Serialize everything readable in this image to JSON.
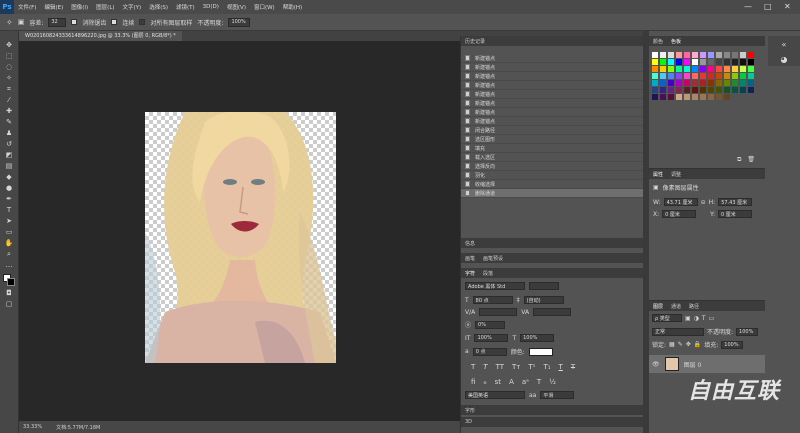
{
  "app": {
    "logo": "Ps"
  },
  "menu": [
    "文件(F)",
    "编辑(E)",
    "图像(I)",
    "图层(L)",
    "文字(Y)",
    "选择(S)",
    "滤镜(T)",
    "3D(D)",
    "视图(V)",
    "窗口(W)",
    "帮助(H)"
  ],
  "window_controls": {
    "minimize": "—",
    "maximize": "□",
    "close": "✕"
  },
  "options": {
    "tolerance_label": "容差:",
    "tolerance_value": "32",
    "antialias_label": "消除锯齿",
    "contiguous_label": "连续",
    "sample_all_label": "对所有图层取样",
    "opacity_label": "不透明度:",
    "opacity_value": "100%"
  },
  "document": {
    "tab_title": "W020160824333614896220.jpg @ 33.3% (图层 0, RGB/8*) *"
  },
  "status": {
    "zoom": "33.33%",
    "doc_size": "文档:5.77M/7.18M"
  },
  "history": {
    "title": "历史记录",
    "items": [
      "新建锚点",
      "新建锚点",
      "新建锚点",
      "新建锚点",
      "新建锚点",
      "新建锚点",
      "新建锚点",
      "新建锚点",
      "闭合路径",
      "选区图形",
      "填充",
      "载入选区",
      "选择反向",
      "羽化",
      "收缩选择",
      "删除通道"
    ],
    "selected_index": 15
  },
  "swatches": {
    "tabs": [
      "颜色",
      "色板"
    ],
    "colors": [
      "#ffffff",
      "#eeeeee",
      "#dddddd",
      "#ff9999",
      "#ff66aa",
      "#ffaacc",
      "#cc99ff",
      "#9999ff",
      "#aaaaaa",
      "#888888",
      "#777777",
      "#cccccc",
      "#ff0000",
      "#ffff00",
      "#00ff00",
      "#00ffff",
      "#0000ff",
      "#ff00ff",
      "#ffffff",
      "#999999",
      "#666666",
      "#444444",
      "#333333",
      "#222222",
      "#111111",
      "#000000",
      "#ff8800",
      "#ffcc00",
      "#88ff00",
      "#00ff88",
      "#00ffcc",
      "#0088ff",
      "#8800ff",
      "#ff0088",
      "#ff4444",
      "#ff8844",
      "#ffcc44",
      "#ccff44",
      "#44ff44",
      "#44ffcc",
      "#44ccff",
      "#4488ff",
      "#8844ff",
      "#ff44cc",
      "#ff6666",
      "#ee3333",
      "#dd2222",
      "#cc4400",
      "#cc8800",
      "#88cc00",
      "#00cc44",
      "#00cc99",
      "#00aacc",
      "#0066cc",
      "#4400cc",
      "#aa00cc",
      "#cc0066",
      "#993333",
      "#aa2222",
      "#883300",
      "#886600",
      "#668800",
      "#228833",
      "#008866",
      "#006688",
      "#224488",
      "#332288",
      "#662288",
      "#882255",
      "#552222",
      "#661111",
      "#553300",
      "#554400",
      "#445500",
      "#115522",
      "#005544",
      "#004455",
      "#112255",
      "#221155",
      "#441155",
      "#551133",
      "#ccaa88",
      "#bb9977",
      "#aa8866",
      "#997755",
      "#886644",
      "#775533",
      "#664422"
    ]
  },
  "properties": {
    "tabs": [
      "属性",
      "调整"
    ],
    "title": "像素图层属性",
    "w_label": "W:",
    "w_value": "43.71 厘米",
    "h_label": "H:",
    "h_value": "57.43 厘米",
    "x_label": "X:",
    "x_value": "0 厘米",
    "y_label": "Y:",
    "y_value": "0 厘米"
  },
  "info": {
    "title": "信息"
  },
  "brushes": {
    "tabs": [
      "画笔",
      "画笔预设"
    ]
  },
  "character": {
    "tabs": [
      "字符",
      "段落"
    ],
    "font": "Adobe 黑体 Std",
    "size": "80 点",
    "leading": "(自动)",
    "kerning": "",
    "tracking": "",
    "scale_pct": "0%",
    "vscale": "100%",
    "hscale": "100%",
    "baseline": "0 点",
    "color_label": "颜色:",
    "language": "美国英语",
    "aa": "平滑"
  },
  "layers": {
    "tabs": [
      "图层",
      "通道",
      "路径"
    ],
    "kind_label": "ρ 类型",
    "blend": "正常",
    "opacity_label": "不透明度:",
    "opacity": "100%",
    "lock_label": "锁定:",
    "fill_label": "填充:",
    "fill": "100%",
    "layer_name": "图层 0"
  },
  "bottom_panels": {
    "glyphs": "字形",
    "three_d": "3D"
  },
  "watermark": "自由互联"
}
